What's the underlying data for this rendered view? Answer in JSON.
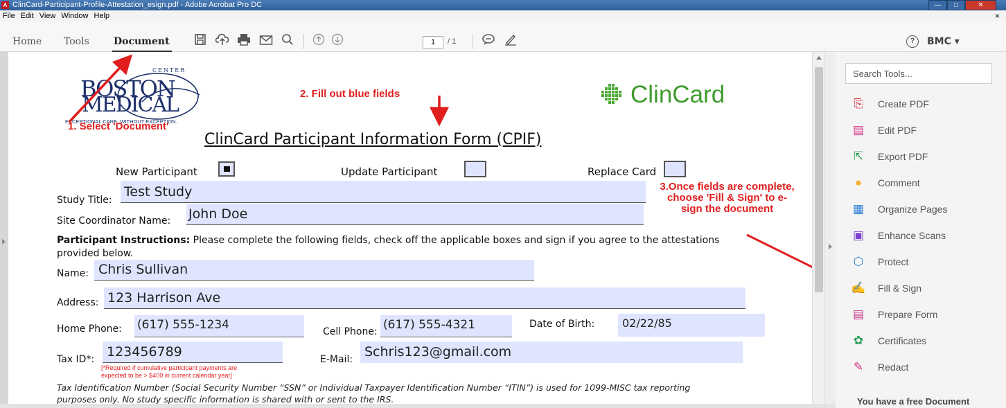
{
  "window": {
    "title": "ClinCard-Participant-Profile-Attestation_esign.pdf - Adobe Acrobat Pro DC",
    "min": "—",
    "max": "□",
    "close": "✕"
  },
  "menu": [
    "File",
    "Edit",
    "View",
    "Window",
    "Help"
  ],
  "menu_close": "×",
  "tabs": {
    "home": "Home",
    "tools": "Tools",
    "document": "Document"
  },
  "page": {
    "current": "1",
    "total": "/ 1"
  },
  "help_icon": "?",
  "user": "BMC ▾",
  "icons": [
    "save-icon",
    "upload-icon",
    "print-icon",
    "email-icon",
    "search-icon",
    "page-up-icon",
    "page-down-icon",
    "comment-icon",
    "sign-icon"
  ],
  "side_panel": {
    "search_placeholder": "Search Tools...",
    "tools": [
      {
        "label": "Create PDF",
        "icon": "create-pdf-icon",
        "color": "#d9263a"
      },
      {
        "label": "Edit PDF",
        "icon": "edit-pdf-icon",
        "color": "#d9338a"
      },
      {
        "label": "Export PDF",
        "icon": "export-pdf-icon",
        "color": "#2aa05a"
      },
      {
        "label": "Comment",
        "icon": "comment-icon",
        "color": "#f2b230"
      },
      {
        "label": "Organize Pages",
        "icon": "organize-icon",
        "color": "#2c7fd6"
      },
      {
        "label": "Enhance Scans",
        "icon": "scan-icon",
        "color": "#7a3fd0"
      },
      {
        "label": "Protect",
        "icon": "shield-icon",
        "color": "#2c7fd6"
      },
      {
        "label": "Fill & Sign",
        "icon": "fill-sign-icon",
        "color": "#6a5cd6"
      },
      {
        "label": "Prepare Form",
        "icon": "form-icon",
        "color": "#c6348c"
      },
      {
        "label": "Certificates",
        "icon": "certificate-icon",
        "color": "#2aa05a"
      },
      {
        "label": "Redact",
        "icon": "redact-icon",
        "color": "#d9338a"
      }
    ],
    "footer": "You have a free Document"
  },
  "form": {
    "logo_top": "CENTER",
    "logo_main1": "BOSTON",
    "logo_main2": "MEDICAL",
    "logo_tag": "EXCEPTIONAL CARE. WITHOUT EXCEPTION.",
    "clincard": "ClinCard",
    "title": "ClinCard Participant Information Form (CPIF)",
    "new_participant": "New Participant",
    "update_participant": "Update Participant",
    "replace_card": "Replace Card",
    "study_title_label": "Study Title:",
    "study_title": "Test Study",
    "coordinator_label": "Site Coordinator Name:",
    "coordinator": "John Doe",
    "instructions_bold": "Participant Instructions:",
    "instructions": " Please complete the following fields, check off the applicable boxes and sign if you agree to the attestations provided below.",
    "name_label": "Name:",
    "name": "Chris Sullivan",
    "address_label": "Address:",
    "address": "123 Harrison Ave",
    "home_phone_label": "Home Phone:",
    "home_phone": "(617) 555-1234",
    "cell_phone_label": "Cell Phone:",
    "cell_phone": "(617) 555-4321",
    "dob_label": "Date of Birth:",
    "dob": "02/22/85",
    "taxid_label": "Tax ID*:",
    "taxid": "123456789",
    "email_label": "E-Mail:",
    "email": "Schris123@gmail.com",
    "required_note1": "[*Required if cumulative participant payments are",
    "required_note2": "expected to be > $400 in current calendar year]",
    "footnote1": "Tax Identification Number (Social Security Number “SSN” or Individual Taxpayer Identification Number “ITIN”) is used for 1099-MISC tax reporting",
    "footnote2": "purposes only. No study specific information is shared with or sent to the IRS."
  },
  "annotations": {
    "a1": "1. Select 'Document'",
    "a2": "2. Fill out blue fields",
    "a3_1": "3.Once fields are complete,",
    "a3_2": "choose 'Fill & Sign' to e-",
    "a3_3": "sign the document"
  }
}
